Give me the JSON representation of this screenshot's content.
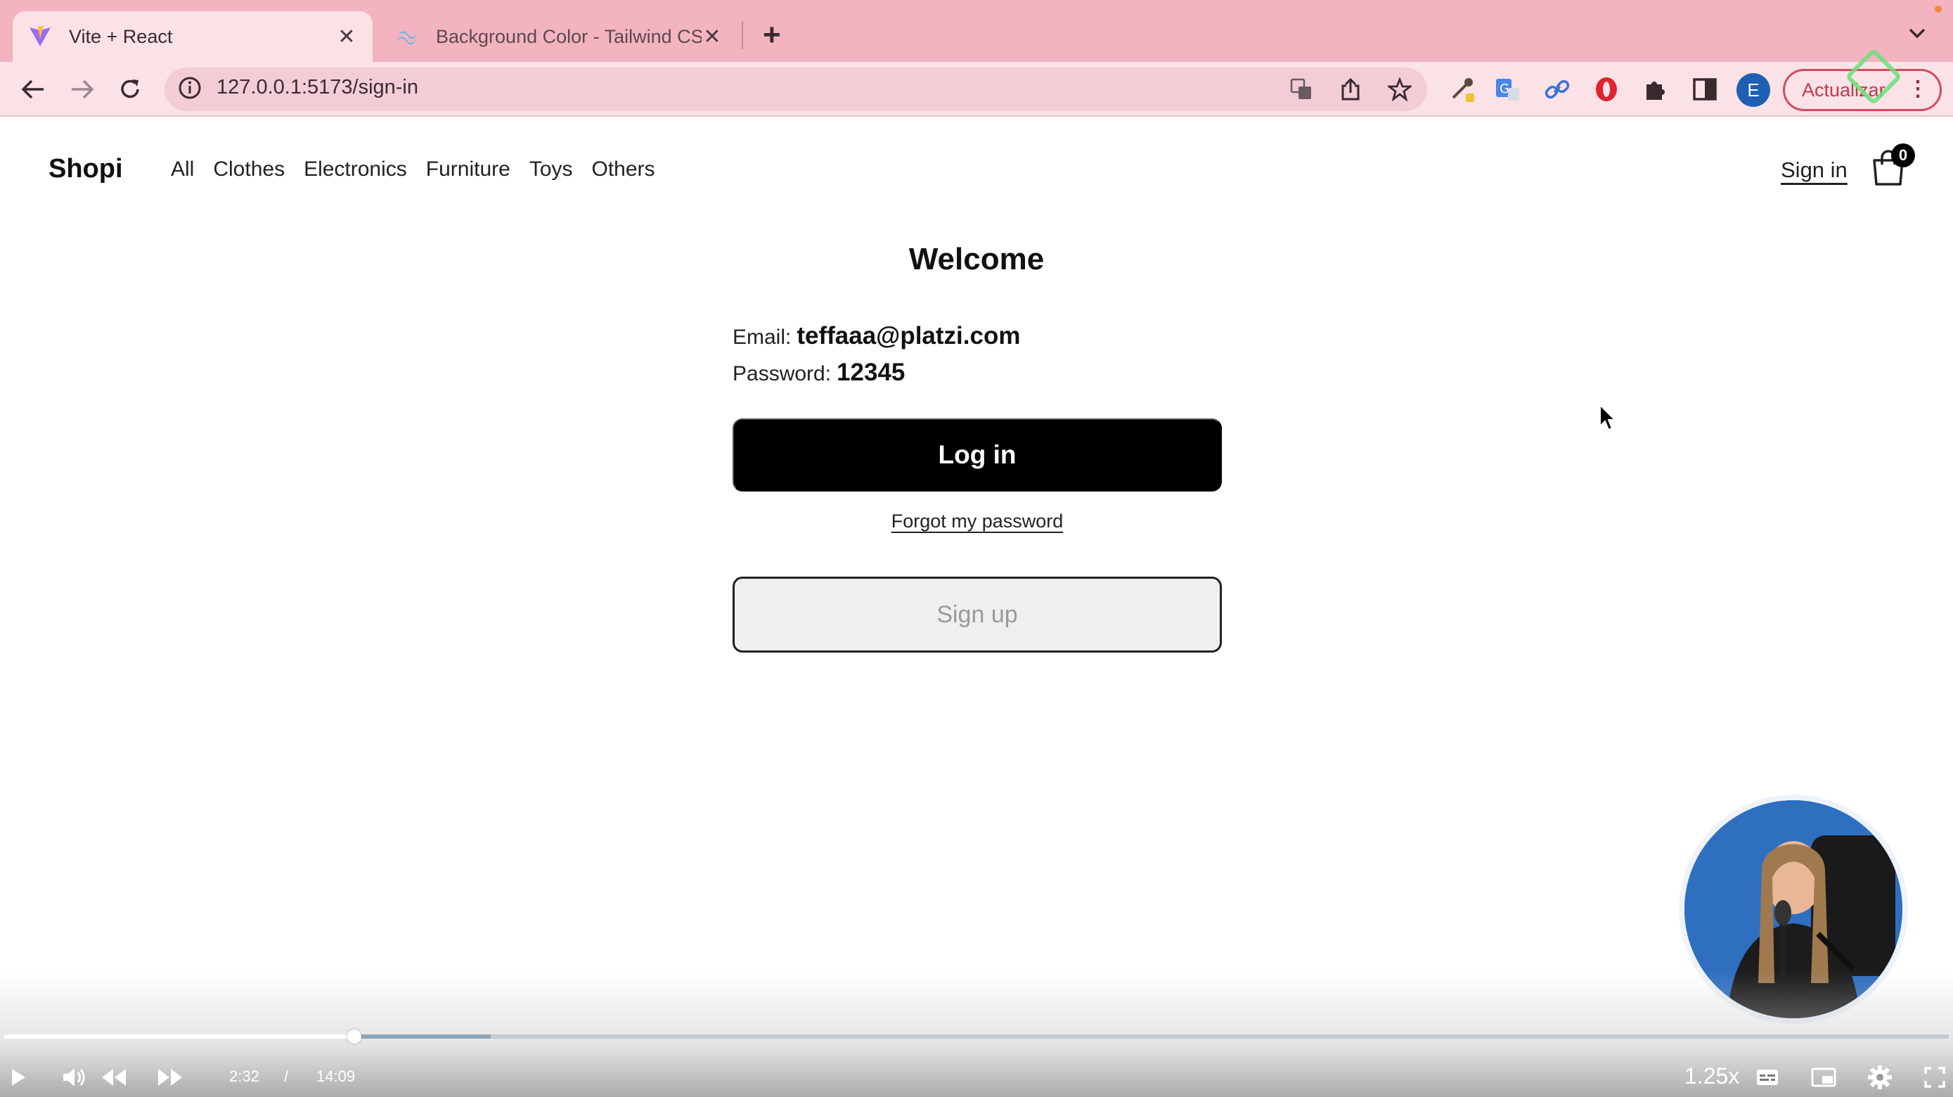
{
  "browser": {
    "tabs": [
      {
        "title": "Vite + React",
        "active": true
      },
      {
        "title": "Background Color - Tailwind CSS",
        "active": false
      }
    ],
    "url": "127.0.0.1:5173/sign-in",
    "profile_initial": "E",
    "update_label": "Actualizar"
  },
  "site": {
    "logo": "Shopi",
    "nav": [
      "All",
      "Clothes",
      "Electronics",
      "Furniture",
      "Toys",
      "Others"
    ],
    "sign_in": "Sign in",
    "cart_count": "0"
  },
  "signin_page": {
    "title": "Welcome",
    "email_label": "Email:",
    "email_value": "teffaaa@platzi.com",
    "password_label": "Password:",
    "password_value": "12345",
    "login_button": "Log in",
    "forgot_link": "Forgot my password",
    "signup_button": "Sign up"
  },
  "player": {
    "current_time": "2:32",
    "separator": "/",
    "duration": "14:09",
    "speed": "1.25x",
    "progress_played": 0.18,
    "progress_buffered": 0.25
  },
  "colors": {
    "tabbar": "#f4b3c0",
    "toolbar": "#fbe2e7",
    "primary_button": "#000000"
  }
}
